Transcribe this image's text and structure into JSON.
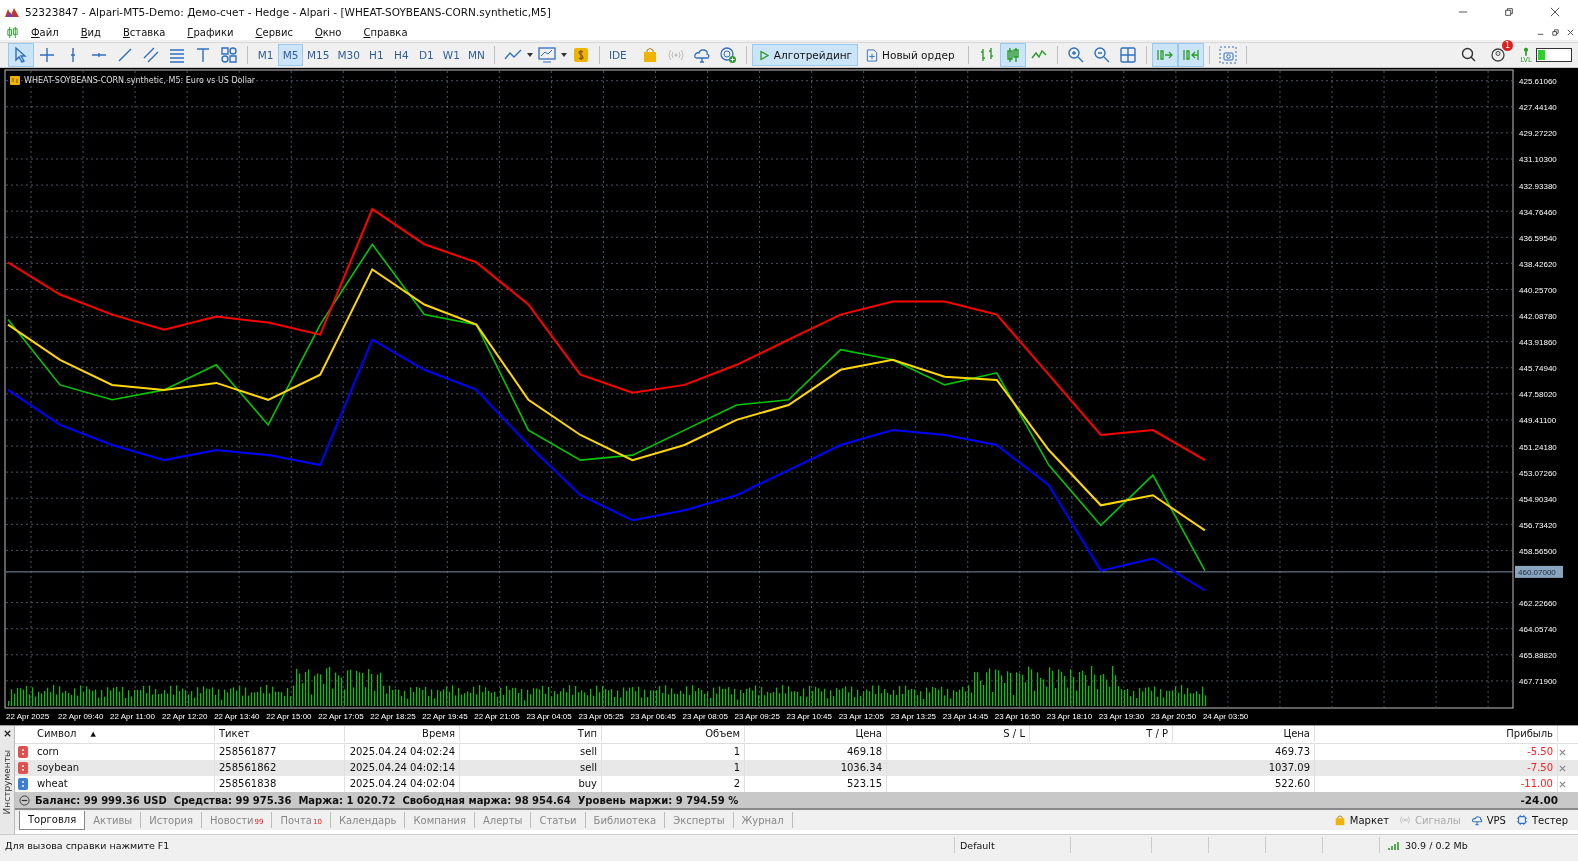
{
  "window": {
    "title": "52323847 - Alpari-MT5-Demo: Демо-счет - Hedge - Alpari - [WHEAT-SOYBEANS-CORN.synthetic,M5]"
  },
  "menu": [
    "Файл",
    "Вид",
    "Вставка",
    "Графики",
    "Сервис",
    "Окно",
    "Справка"
  ],
  "toolbar": {
    "drawing_tools": [
      {
        "selected": true
      },
      {
        "selected": false
      },
      {
        "selected": false
      },
      {
        "selected": false
      },
      {
        "selected": false
      },
      {
        "selected": false
      },
      {
        "selected": false
      },
      {
        "selected": false
      },
      {
        "selected": false
      }
    ],
    "timeframes": [
      {
        "label": "M1",
        "selected": false
      },
      {
        "label": "M5",
        "selected": true
      },
      {
        "label": "M15",
        "selected": false
      },
      {
        "label": "M30",
        "selected": false
      },
      {
        "label": "H1",
        "selected": false
      },
      {
        "label": "H4",
        "selected": false
      },
      {
        "label": "D1",
        "selected": false
      },
      {
        "label": "W1",
        "selected": false
      },
      {
        "label": "MN",
        "selected": false
      }
    ],
    "ide_label": "IDE",
    "algotrading": {
      "label": "Алготрейдинг",
      "on": true
    },
    "new_order": "Новый ордер",
    "chart_types": [
      {
        "selected": false
      },
      {
        "selected": true
      },
      {
        "selected": false
      }
    ],
    "scroll_tools": [
      {
        "selected": true
      },
      {
        "selected": true
      }
    ],
    "notifications_badge": "1",
    "lvl_label": "LVL"
  },
  "chart": {
    "chart_data": {
      "type": "line",
      "title": "WHEAT-SOYBEANS-CORN.synthetic, M5: Euro vs US Dollar",
      "grid": true,
      "ref_lines": [
        {
          "axis": "y",
          "value": 460.07,
          "label": "460.07000"
        }
      ],
      "categories": [
        "22 Apr 2025",
        "22 Apr 09:40",
        "22 Apr 11:00",
        "22 Apr 12:20",
        "22 Apr 13:40",
        "22 Apr 15:00",
        "22 Apr 17:05",
        "22 Apr 18:25",
        "22 Apr 19:45",
        "22 Apr 21:05",
        "23 Apr 04:05",
        "23 Apr 05:25",
        "23 Apr 06:45",
        "23 Apr 08:05",
        "23 Apr 09:25",
        "23 Apr 10:45",
        "23 Apr 12:05",
        "23 Apr 13:25",
        "23 Apr 14:45",
        "23 Apr 16:50",
        "23 Apr 18:10",
        "23 Apr 19:30",
        "23 Apr 20:50",
        "24 Apr 03:50"
      ],
      "ylim": [
        469.62,
        424.86
      ],
      "yticks": [
        {
          "value": 425.6106,
          "label": "425.61060"
        },
        {
          "value": 427.4414,
          "label": "427.44140"
        },
        {
          "value": 429.2722,
          "label": "429.27220"
        },
        {
          "value": 431.103,
          "label": "431.10300"
        },
        {
          "value": 432.9338,
          "label": "432.93380"
        },
        {
          "value": 434.7646,
          "label": "434.76460"
        },
        {
          "value": 436.5954,
          "label": "436.59540"
        },
        {
          "value": 438.4262,
          "label": "438.42620"
        },
        {
          "value": 440.257,
          "label": "440.25700"
        },
        {
          "value": 442.0878,
          "label": "442.08780"
        },
        {
          "value": 443.9186,
          "label": "443.91860"
        },
        {
          "value": 445.7494,
          "label": "445.74940"
        },
        {
          "value": 447.5802,
          "label": "447.58020"
        },
        {
          "value": 449.411,
          "label": "449.41100"
        },
        {
          "value": 451.2418,
          "label": "451.24180"
        },
        {
          "value": 453.0726,
          "label": "453.07260"
        },
        {
          "value": 454.9034,
          "label": "454.90340"
        },
        {
          "value": 456.7342,
          "label": "456.73420"
        },
        {
          "value": 458.565,
          "label": "458.56500"
        },
        {
          "value": 462.2266,
          "label": "462.22660"
        },
        {
          "value": 464.0574,
          "label": "464.05740"
        },
        {
          "value": 465.8882,
          "label": "465.88820"
        },
        {
          "value": 467.719,
          "label": "467.71900"
        }
      ],
      "series": [
        {
          "color": "#00c800",
          "values": [
            442.37,
            446.95,
            448.0,
            447.3,
            445.54,
            449.76,
            442.72,
            437.09,
            442.02,
            442.72,
            450.12,
            452.23,
            451.88,
            450.12,
            448.36,
            448.0,
            444.48,
            445.19,
            446.95,
            446.1,
            452.58,
            456.81,
            453.28,
            459.98
          ]
        },
        {
          "color": "#ff0000",
          "values": [
            438.36,
            440.61,
            442.02,
            443.07,
            442.16,
            442.58,
            443.43,
            434.62,
            437.09,
            438.36,
            441.31,
            446.24,
            447.51,
            446.95,
            445.54,
            443.78,
            442.02,
            441.1,
            441.1,
            442.02,
            446.24,
            450.47,
            450.12,
            452.23
          ]
        },
        {
          "color": "#ffd700",
          "values": [
            442.72,
            445.19,
            446.95,
            447.3,
            446.81,
            448.0,
            446.24,
            438.85,
            441.31,
            442.72,
            448.0,
            450.47,
            452.23,
            451.17,
            449.41,
            448.36,
            445.89,
            445.19,
            446.38,
            446.6,
            451.52,
            455.4,
            454.69,
            457.16
          ]
        },
        {
          "color": "#0000ff",
          "values": [
            447.3,
            449.76,
            451.17,
            452.23,
            451.52,
            451.88,
            452.58,
            443.78,
            445.89,
            447.3,
            451.17,
            454.69,
            456.45,
            455.75,
            454.69,
            452.93,
            451.17,
            450.12,
            450.47,
            451.17,
            453.99,
            459.98,
            459.13,
            461.38
          ]
        }
      ]
    }
  },
  "toolbox": {
    "panel_title": "Инструменты",
    "columns": [
      {
        "label": "Символ",
        "sort_mark": "▲"
      },
      {
        "label": "Тикет"
      },
      {
        "label": "Время"
      },
      {
        "label": "Тип"
      },
      {
        "label": "Объем"
      },
      {
        "label": "Цена"
      },
      {
        "label": "S / L"
      },
      {
        "label": "T / P"
      },
      {
        "label": "Цена"
      },
      {
        "label": "Прибыль"
      }
    ],
    "rows": [
      {
        "symbol": "corn",
        "ticket": "258561877",
        "time": "2025.04.24 04:02:24",
        "type": "sell",
        "volume": "1",
        "price": "469.18",
        "current_price": "469.73",
        "profit": "-5.50",
        "color": "#e05050"
      },
      {
        "symbol": "soybean",
        "ticket": "258561862",
        "time": "2025.04.24 04:02:14",
        "type": "sell",
        "volume": "1",
        "price": "1036.34",
        "current_price": "1037.09",
        "profit": "-7.50",
        "color": "#e05050"
      },
      {
        "symbol": "wheat",
        "ticket": "258561838",
        "time": "2025.04.24 04:02:04",
        "type": "buy",
        "volume": "2",
        "price": "523.15",
        "current_price": "522.60",
        "profit": "-11.00",
        "color": "#3a7fd0"
      }
    ],
    "account_summary": "Баланс: 99 999.36 USD  Средства: 99 975.36  Маржа: 1 020.72  Свободная маржа: 98 954.64  Уровень маржи: 9 794.59 %",
    "total_profit": "-24.00",
    "tabs": [
      {
        "label": "Торговля",
        "selected": true
      },
      {
        "label": "Активы",
        "selected": false
      },
      {
        "label": "История",
        "selected": false
      },
      {
        "label": "Новости",
        "badge": "99",
        "selected": false
      },
      {
        "label": "Почта",
        "badge": "10",
        "selected": false
      },
      {
        "label": "Календарь",
        "selected": false
      },
      {
        "label": "Компания",
        "selected": false
      },
      {
        "label": "Алерты",
        "selected": false
      },
      {
        "label": "Статьи",
        "selected": false
      },
      {
        "label": "Библиотека",
        "selected": false
      },
      {
        "label": "Эксперты",
        "selected": false
      },
      {
        "label": "Журнал",
        "selected": false
      }
    ],
    "services": [
      {
        "label": "Маркет",
        "disabled": false
      },
      {
        "label": "Сигналы",
        "disabled": true
      },
      {
        "label": "VPS",
        "disabled": false
      },
      {
        "label": "Тестер",
        "disabled": false
      }
    ]
  },
  "status_bar": {
    "help": "Для вызова справки нажмите F1",
    "profile": "Default",
    "traffic": "30.9 / 0.2 Mb"
  }
}
